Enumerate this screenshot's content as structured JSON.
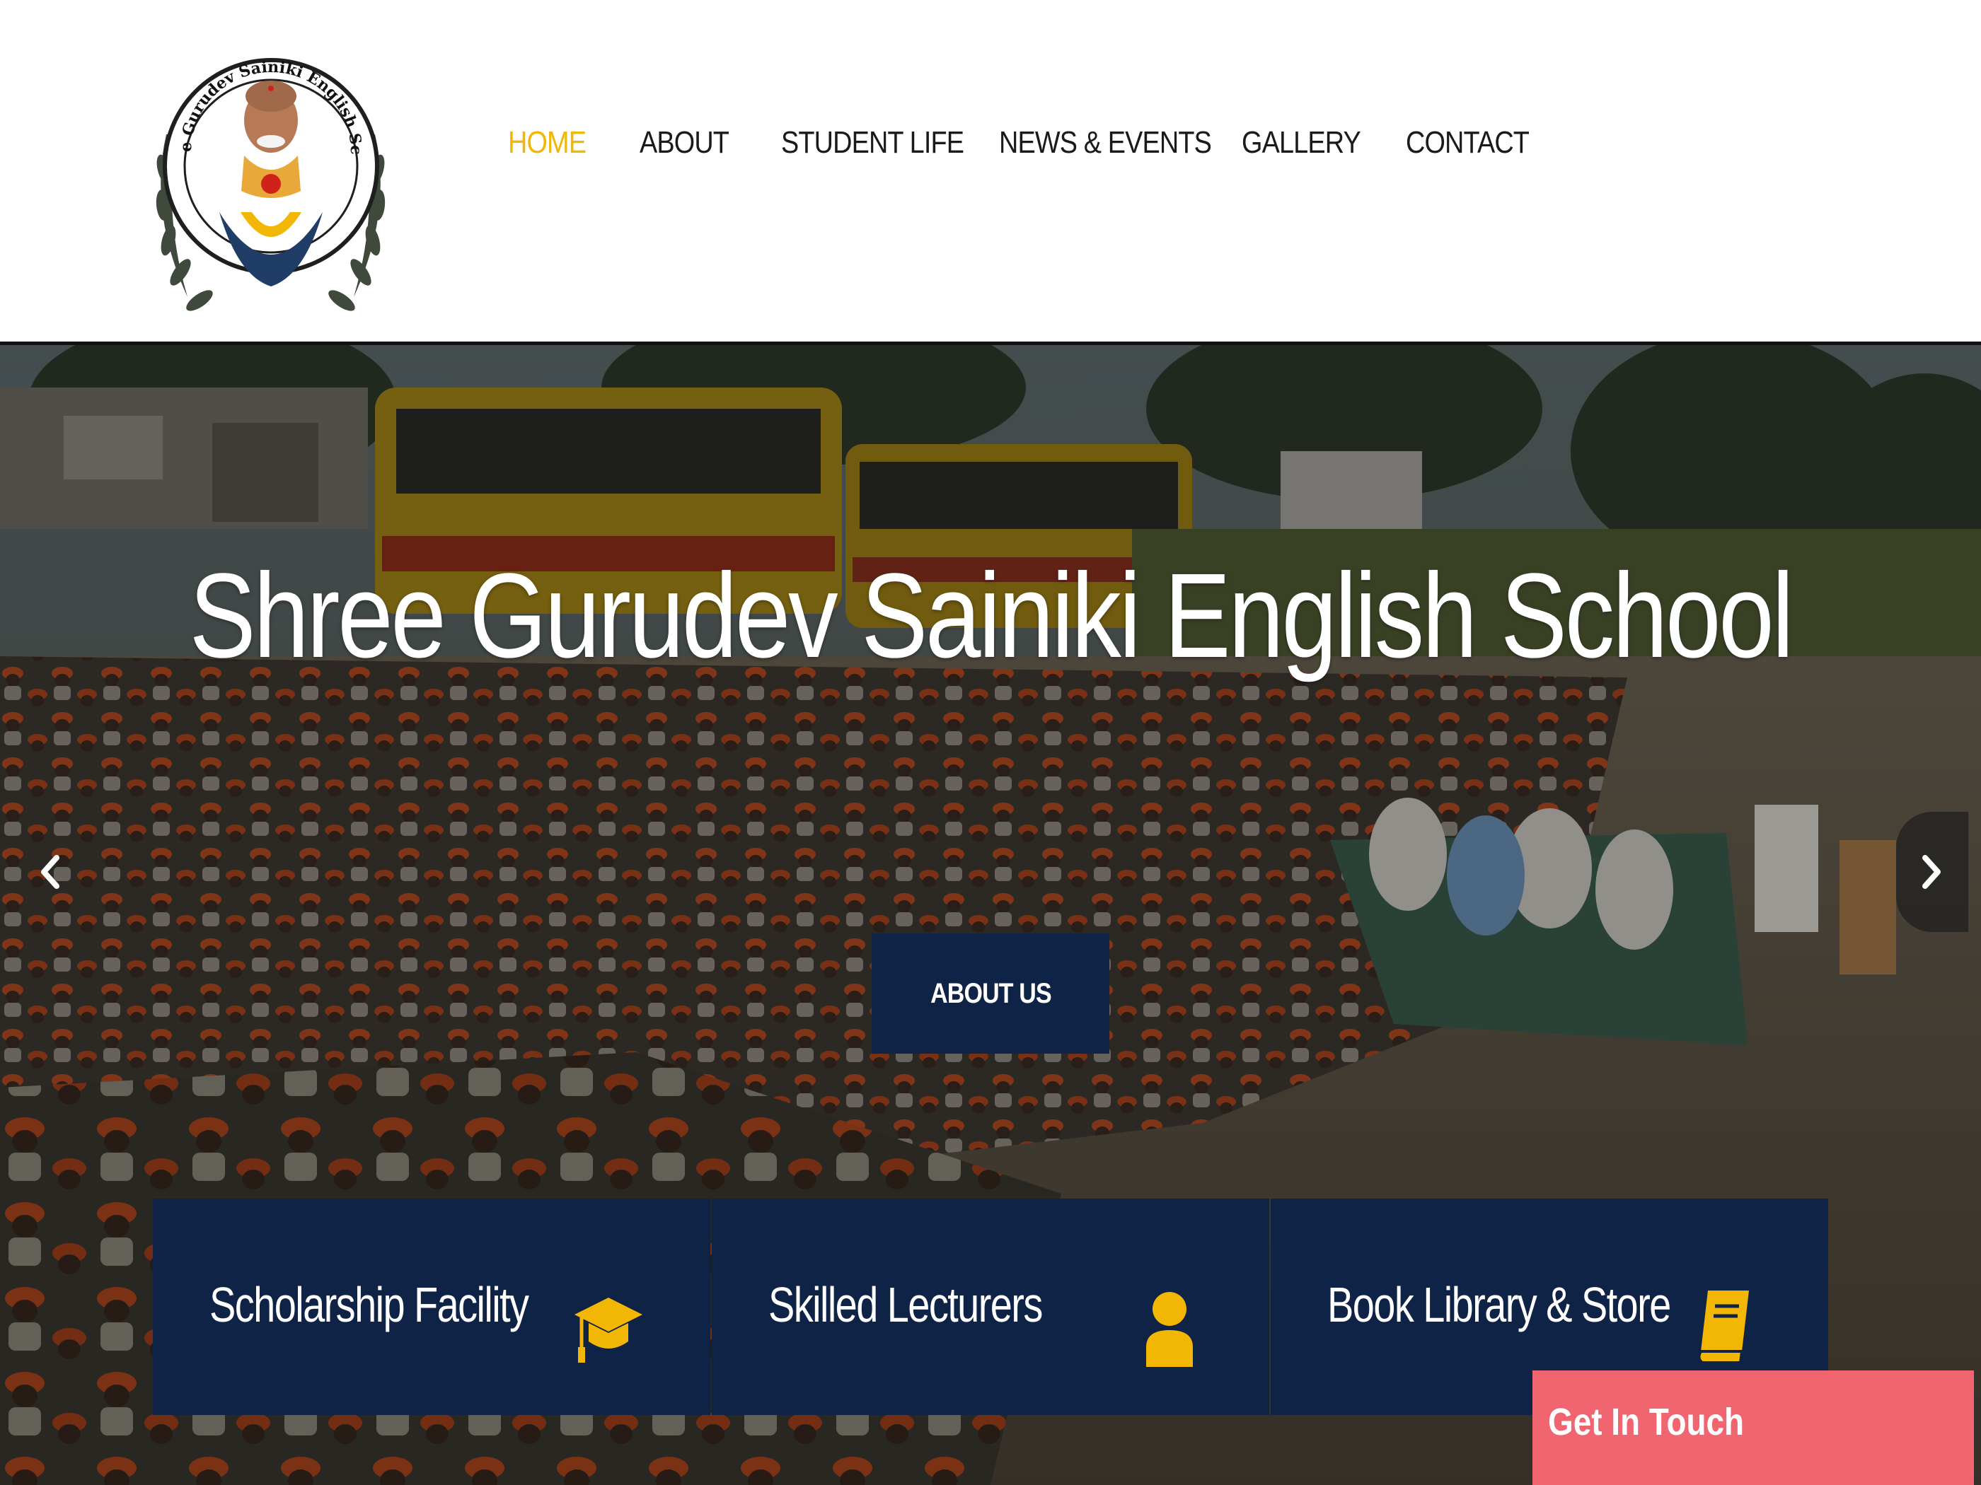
{
  "brand": {
    "logo_text": "Shree Gurudev Sainiki English School"
  },
  "nav": {
    "items": [
      {
        "label": "HOME",
        "active": true
      },
      {
        "label": "ABOUT"
      },
      {
        "label": "STUDENT LIFE"
      },
      {
        "label": "NEWS & EVENTS"
      },
      {
        "label": "GALLERY"
      },
      {
        "label": "CONTACT"
      }
    ]
  },
  "hero": {
    "title": "Shree Gurudev Sainiki English School",
    "button_label": "ABOUT US",
    "prev_icon": "chevron-left-icon",
    "next_icon": "chevron-right-icon"
  },
  "features": [
    {
      "label": "Scholarship Facility",
      "icon": "graduation-cap-icon"
    },
    {
      "label": "Skilled Lecturers",
      "icon": "user-icon"
    },
    {
      "label": "Book Library & Store",
      "icon": "book-icon"
    }
  ],
  "contact_widget": {
    "label": "Get In Touch"
  },
  "colors": {
    "accent": "#f2b705",
    "navy": "#0f2347",
    "touch": "#f0656f"
  }
}
